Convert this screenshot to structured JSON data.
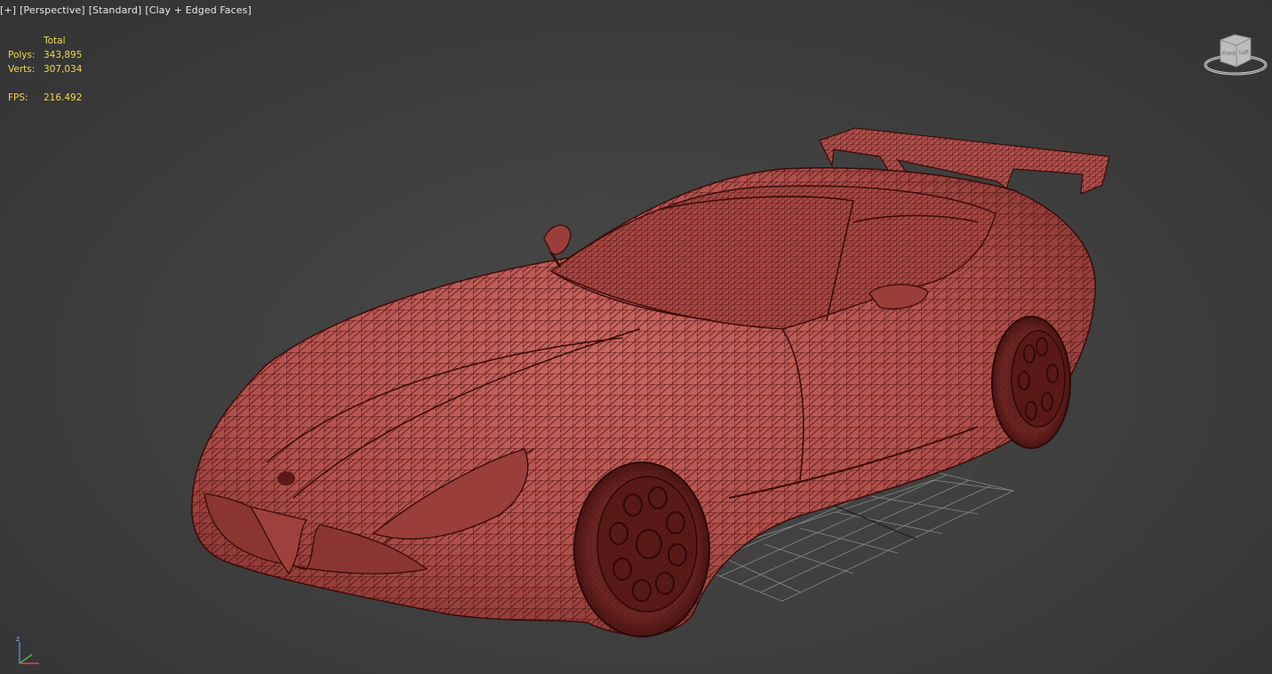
{
  "viewport": {
    "labels": [
      "[+]",
      "[Perspective]",
      "[Standard]",
      "[Clay + Edged Faces]"
    ]
  },
  "stats": {
    "header": "Total",
    "polys_label": "Polys:",
    "polys_value": "343,895",
    "verts_label": "Verts:",
    "verts_value": "307,034",
    "fps_label": "FPS:",
    "fps_value": "216.492"
  },
  "viewcube": {
    "front": "Front",
    "left": "Left"
  },
  "axis": {
    "z": "z"
  },
  "colors": {
    "background": "#404040",
    "stats_text": "#f2d84a",
    "clay": "#b45450",
    "wire": "#4a1010",
    "grid": "#9a9a9a"
  },
  "icons": [
    "viewcube-icon",
    "axis-tripod-icon"
  ]
}
